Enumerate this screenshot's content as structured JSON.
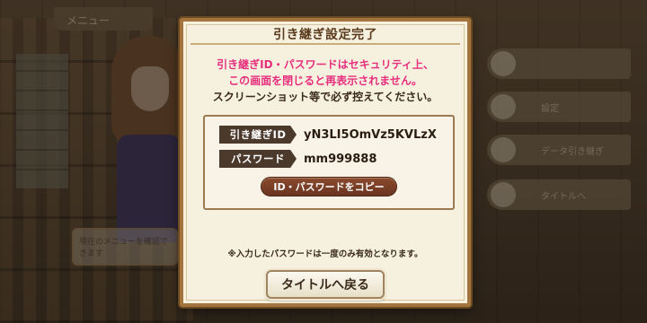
{
  "background": {
    "menu_tab": "メニュー",
    "message_box": "現在のメニューを確認できます",
    "side_buttons": [
      "",
      "設定",
      "データ引き継ぎ",
      "タイトルへ"
    ]
  },
  "dialog": {
    "title": "引き継ぎ設定完了",
    "warning_lines": [
      "引き継ぎID・パスワードはセキュリティ上、",
      "この画面を閉じると再表示されません。"
    ],
    "instruction": "スクリーンショット等で必ず控えてください。",
    "id_label": "引き継ぎID",
    "id_value": "yN3LI5OmVz5KVLzX",
    "password_label": "パスワード",
    "password_value": "mm999888",
    "copy_button": "ID・パスワードをコピー",
    "footnote": "※入力したパスワードは一度のみ有効となります。",
    "back_button": "タイトルへ戻る"
  },
  "colors": {
    "warning_text": "#e62f7d",
    "frame": "#a3743d",
    "copy_button": "#7a3f26"
  }
}
